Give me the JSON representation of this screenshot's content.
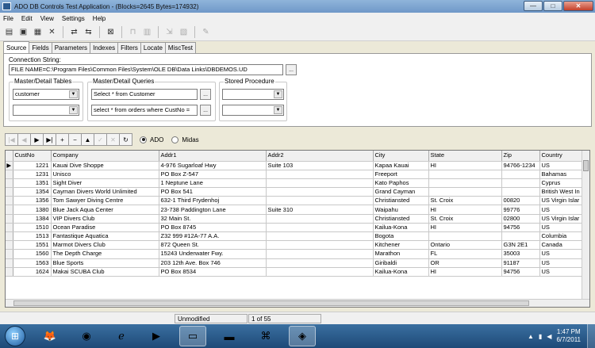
{
  "window": {
    "title": "ADO DB Controls Test Application - (Blocks=2645 Bytes=174932)",
    "buttons": {
      "minimize": "—",
      "maximize": "□",
      "close": "✕"
    }
  },
  "menu": [
    "File",
    "Edit",
    "View",
    "Settings",
    "Help"
  ],
  "toolbar": {
    "icons": [
      "open-db-icon",
      "save-icon",
      "open-folder-icon",
      "delete-icon",
      "connect-icon",
      "disconnect-icon",
      "cancel-icon",
      "lock-icon",
      "table-icon",
      "rename-icon",
      "columns-icon",
      "edit-icon"
    ]
  },
  "tabs": [
    "Source",
    "Fields",
    "Parameters",
    "Indexes",
    "Filters",
    "Locate",
    "MiscTest"
  ],
  "source": {
    "connection_label": "Connection String:",
    "connection_value": "FILE NAME=C:\\Program Files\\Common Files\\System\\OLE DB\\Data Links\\DBDEMOS.UD",
    "browse_label": "...",
    "master_detail_tables_label": "Master/Detail Tables",
    "master_table": "customer",
    "detail_table": "",
    "master_detail_queries_label": "Master/Detail Queries",
    "master_query": "Select * from Customer",
    "detail_query": "select * from orders where CustNo =",
    "stored_procedure_label": "Stored Procedure",
    "stored_procedure": "",
    "stored_procedure_2": ""
  },
  "navigator": {
    "buttons": [
      "|◀",
      "◀",
      "▶",
      "▶|",
      "+",
      "−",
      "▲",
      "✓",
      "✕",
      "↻"
    ],
    "radio_ado": "ADO",
    "radio_midas": "Midas",
    "selected": "ADO"
  },
  "grid": {
    "columns": [
      "CustNo",
      "Company",
      "Addr1",
      "Addr2",
      "City",
      "State",
      "Zip",
      "Country"
    ],
    "rows": [
      [
        "1221",
        "Kauai Dive Shoppe",
        "4-976 Sugarloaf Hwy",
        "Suite 103",
        "Kapaa Kauai",
        "HI",
        "94766-1234",
        "US"
      ],
      [
        "1231",
        "Unisco",
        "PO Box Z-547",
        "",
        "Freeport",
        "",
        "",
        "Bahamas"
      ],
      [
        "1351",
        "Sight Diver",
        "1 Neptune Lane",
        "",
        "Kato Paphos",
        "",
        "",
        "Cyprus"
      ],
      [
        "1354",
        "Cayman Divers World Unlimited",
        "PO Box 541",
        "",
        "Grand Cayman",
        "",
        "",
        "British West In"
      ],
      [
        "1356",
        "Tom Sawyer Diving Centre",
        "632-1 Third Frydenhoj",
        "",
        "Christiansted",
        "St. Croix",
        "00820",
        "US Virgin Islar"
      ],
      [
        "1380",
        "Blue Jack Aqua Center",
        "23-738 Paddington Lane",
        "Suite 310",
        "Waipahu",
        "HI",
        "99776",
        "US"
      ],
      [
        "1384",
        "VIP Divers Club",
        "32 Main St.",
        "",
        "Christiansted",
        "St. Croix",
        "02800",
        "US Virgin Islar"
      ],
      [
        "1510",
        "Ocean Paradise",
        "PO Box 8745",
        "",
        "Kailua-Kona",
        "HI",
        "94756",
        "US"
      ],
      [
        "1513",
        "Fantastique Aquatica",
        "Z32 999 #12A-77 A.A.",
        "",
        "Bogota",
        "",
        "",
        "Columbia"
      ],
      [
        "1551",
        "Marmot Divers Club",
        "872 Queen St.",
        "",
        "Kitchener",
        "Ontario",
        "G3N 2E1",
        "Canada"
      ],
      [
        "1560",
        "The Depth Charge",
        "15243 Underwater Fwy.",
        "",
        "Marathon",
        "FL",
        "35003",
        "US"
      ],
      [
        "1563",
        "Blue Sports",
        "203 12th Ave. Box 746",
        "",
        "Giribaldi",
        "OR",
        "91187",
        "US"
      ],
      [
        "1624",
        "Makai SCUBA Club",
        "PO Box 8534",
        "",
        "Kailua-Kona",
        "HI",
        "94756",
        "US"
      ]
    ]
  },
  "status": {
    "state": "Unmodified",
    "position": "1 of 55"
  },
  "taskbar": {
    "time": "1:47 PM",
    "date": "6/7/2011"
  }
}
